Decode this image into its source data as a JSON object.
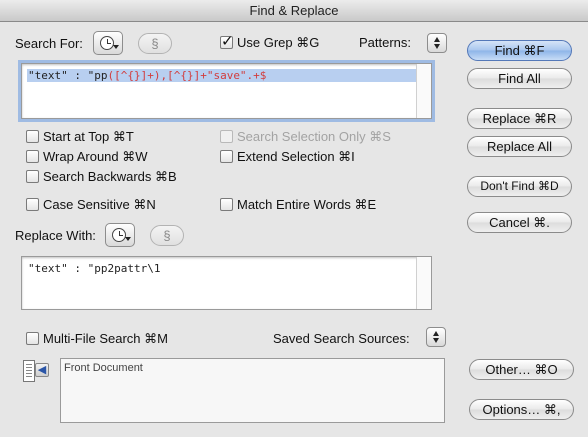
{
  "window": {
    "title": "Find & Replace"
  },
  "search": {
    "label": "Search For:",
    "section_symbol": "§",
    "text_prefix": "\"text\" : \"pp",
    "text_regex": "([^{}]+),[^{}]+\"save\".+$",
    "use_grep_label": "Use Grep  ⌘G",
    "use_grep_checked": true,
    "patterns_label": "Patterns:"
  },
  "options": {
    "start_at_top": "Start at Top  ⌘T",
    "wrap_around": "Wrap Around  ⌘W",
    "search_backwards": "Search Backwards  ⌘B",
    "case_sensitive": "Case Sensitive  ⌘N",
    "search_selection_only": "Search Selection Only  ⌘S",
    "extend_selection": "Extend Selection  ⌘I",
    "match_entire_words": "Match Entire Words  ⌘E"
  },
  "replace": {
    "label": "Replace With:",
    "section_symbol": "§",
    "text": "\"text\" : \"pp2pattr\\1"
  },
  "multifile": {
    "label": "Multi-File Search  ⌘M",
    "saved_sources_label": "Saved Search Sources:",
    "source_item": "Front Document"
  },
  "buttons": {
    "find": "Find  ⌘F",
    "find_all": "Find All",
    "replace": "Replace  ⌘R",
    "replace_all": "Replace All",
    "dont_find": "Don't Find ⌘D",
    "cancel": "Cancel  ⌘.",
    "other": "Other…  ⌘O",
    "options": "Options…  ⌘,"
  },
  "colors": {
    "default_button": "#a8c6ee",
    "selection": "#b8cff0",
    "focus_ring": "#9fbbe3",
    "regex_text": "#d23c3c"
  }
}
